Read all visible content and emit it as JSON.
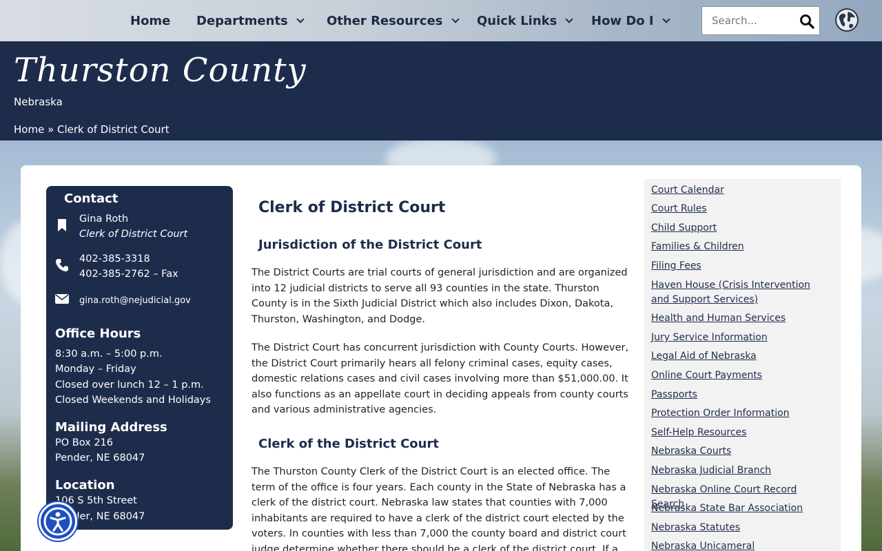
{
  "nav": {
    "items": [
      {
        "label": "Home"
      },
      {
        "label": "Departments"
      },
      {
        "label": "Other Resources"
      },
      {
        "label": "Quick Links"
      },
      {
        "label": "How Do I"
      }
    ],
    "search_placeholder": "Search..."
  },
  "banner": {
    "title": "Thurston County",
    "subtitle": "Nebraska",
    "breadcrumb_home": "Home",
    "breadcrumb_sep": " » ",
    "breadcrumb_current": "Clerk of District Court"
  },
  "contact": {
    "heading": "Contact",
    "name": "Gina Roth",
    "role": "Clerk of District Court",
    "phone": "402-385-3318",
    "fax": "402-385-2762 – Fax",
    "email": "gina.roth@nejudicial.gov",
    "hours_heading": "Office Hours",
    "hours": [
      "8:30 a.m. – 5:00 p.m.",
      "Monday – Friday",
      "Closed over lunch 12 – 1 p.m.",
      "Closed Weekends and Holidays"
    ],
    "mailing_heading": "Mailing Address",
    "mailing": [
      "PO Box 216",
      "Pender, NE 68047"
    ],
    "location_heading": "Location",
    "location": [
      "106 S 5th Street",
      "Pender, NE 68047"
    ]
  },
  "main": {
    "title": "Clerk of District Court",
    "h2_1": "Jurisdiction of the District Court",
    "p1": "The District Courts are trial courts of general jurisdiction and are organized into 12 judicial districts to serve all 93 counties in the state. Thurston County is in the Sixth Judicial District which also includes Dixon, Dakota, Thurston, Washington, and Dodge.",
    "p2": "The District Court has concurrent jurisdiction with County Courts. However, the District Court primarily hears all felony criminal cases, equity cases, domestic relations cases and civil cases involving more than $51,000.00. It also functions as an appellate court in deciding appeals from county courts and various administrative agencies.",
    "h2_2": "Clerk of the District Court",
    "p3": "The Thurston County Clerk of the District Court is an elected office. The term of the office is four years. Each county in the State of Nebraska has a clerk of the district court. Nebraska law states that counties with 7,000 inhabitants are required to have a clerk of the district court elected by the voters. In counties with less than 7,000 the county board and district court judge determine whether there should be a clerk of the district court. If a clerk does not exist, the county"
  },
  "links": [
    "Court Calendar",
    "Court Rules",
    "Child Support",
    "Families & Children",
    "Filing Fees",
    "Haven House (Crisis Intervention and Support Services)",
    "Health and Human Services",
    "Jury Service Information",
    "Legal Aid of Nebraska",
    "Online Court Payments",
    "Passports",
    "Protection Order Information",
    "Self-Help Resources",
    "Nebraska Courts",
    "Nebraska Judicial Branch",
    "Nebraska Online Court Record Search",
    "Nebraska State Bar Association",
    "Nebraska Statutes",
    "Nebraska Unicameral"
  ],
  "colors": {
    "navy": "#1e2c4c",
    "accessibility_blue": "#1f4fbf"
  }
}
